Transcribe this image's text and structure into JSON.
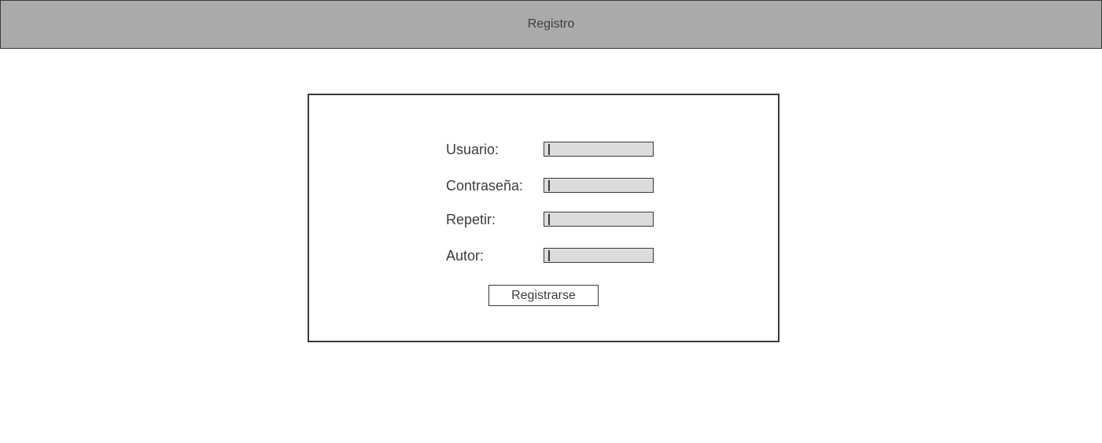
{
  "header": {
    "title": "Registro"
  },
  "form": {
    "fields": [
      {
        "label": "Usuario:",
        "value": ""
      },
      {
        "label": "Contraseña:",
        "value": ""
      },
      {
        "label": "Repetir:",
        "value": ""
      },
      {
        "label": "Autor:",
        "value": ""
      }
    ],
    "submit_label": "Registrarse"
  },
  "colors": {
    "header_background": "#aaaaaa",
    "input_background": "#dcdcdc",
    "border": "#3a3a3a",
    "text": "#3c3c3c"
  }
}
